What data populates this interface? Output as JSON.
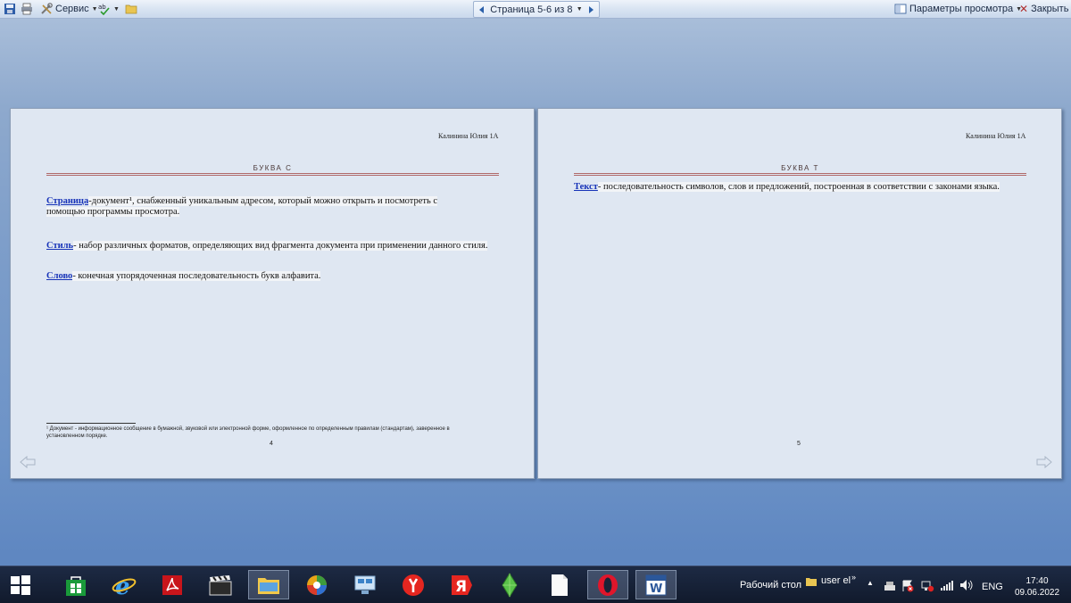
{
  "toolbar": {
    "service_label": "Сервис",
    "page_indicator": "Страница 5-6 из 8",
    "view_options_label": "Параметры просмотра",
    "close_label": "Закрыть"
  },
  "left_page": {
    "author": "Калинина Юлия 1А",
    "section_title": "БУКВА С",
    "entries": [
      {
        "term": "Страница",
        "text": "-документ¹, снабженный уникальным адресом, который можно открыть и посмотреть с помощью программы просмотра."
      },
      {
        "term": "Стиль",
        "text": "- набор различных форматов, определяющих вид фрагмента документа при применении данного стиля."
      },
      {
        "term": "Слово",
        "text": "- конечная упорядоченная последовательность букв алфавита."
      }
    ],
    "footnote": "¹ Документ - информационное сообщение в бумажной, звуковой или электронной форме, оформленное по определенным правилам (стандартам), заверенное в установленном порядке.",
    "page_number": "4"
  },
  "right_page": {
    "author": "Калинина Юлия 1А",
    "section_title": "БУКВА Т",
    "entries": [
      {
        "term": "Текст",
        "text": "- последовательность символов, слов и предложений, построенная в соответствии с законами языка."
      }
    ],
    "page_number": "5"
  },
  "taskbar": {
    "desktop_label": "Рабочий стол",
    "user_label": "user el",
    "language": "ENG",
    "time": "17:40",
    "date": "09.06.2022",
    "icons": [
      "windows-start",
      "store",
      "internet-explorer",
      "acrobat",
      "media-player",
      "file-explorer",
      "picasa",
      "network-manager",
      "yandex-browser",
      "yandex",
      "sims",
      "blank-document",
      "opera",
      "word"
    ]
  }
}
